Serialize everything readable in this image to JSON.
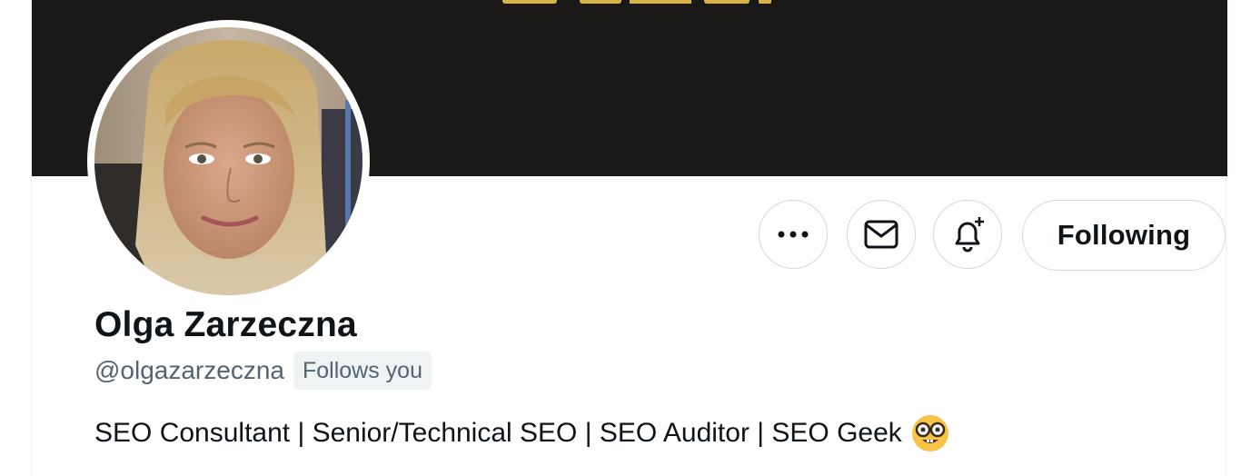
{
  "profile": {
    "name": "Olga Zarzeczna",
    "handle": "@olgazarzeczna",
    "follows_you_badge": "Follows you",
    "bio": "SEO Consultant | Senior/Technical SEO | SEO Auditor | SEO Geek",
    "bio_emoji": "nerd-face-emoji"
  },
  "actions": {
    "more": {
      "icon": "more-dots-icon"
    },
    "message": {
      "icon": "envelope-icon"
    },
    "notifications": {
      "icon": "bell-plus-icon"
    },
    "following_label": "Following"
  },
  "banner": {
    "background_color": "#1b1918",
    "logo_color": "#d8b24a"
  },
  "colors": {
    "text_primary": "#0f1419",
    "text_secondary": "#536471",
    "border": "#cfd9de",
    "badge_bg": "#eff3f4"
  }
}
